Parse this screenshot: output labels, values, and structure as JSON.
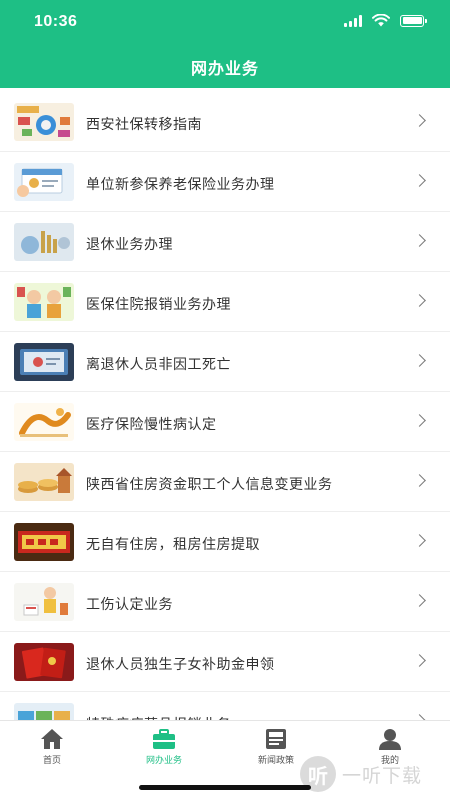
{
  "status_bar": {
    "time": "10:36"
  },
  "header": {
    "title": "网办业务"
  },
  "list": {
    "items": [
      {
        "label": "西安社保转移指南",
        "thumb_icon": "social-insurance-diagram-thumb"
      },
      {
        "label": "单位新参保养老保险业务办理",
        "thumb_icon": "insurance-card-thumb"
      },
      {
        "label": "退休业务办理",
        "thumb_icon": "retirement-thumb"
      },
      {
        "label": "医保住院报销业务办理",
        "thumb_icon": "elderly-couple-thumb"
      },
      {
        "label": "离退休人员非因工死亡",
        "thumb_icon": "certificate-thumb"
      },
      {
        "label": "医疗保险慢性病认定",
        "thumb_icon": "medical-insurance-thumb"
      },
      {
        "label": "陕西省住房资金职工个人信息变更业务",
        "thumb_icon": "housing-fund-thumb"
      },
      {
        "label": "无自有住房，租房住房提取",
        "thumb_icon": "rental-housing-thumb"
      },
      {
        "label": "工伤认定业务",
        "thumb_icon": "work-injury-thumb"
      },
      {
        "label": "退休人员独生子女补助金申领",
        "thumb_icon": "red-booklet-thumb"
      },
      {
        "label": "特殊疾病药品报销业务",
        "thumb_icon": "medicine-thumb"
      }
    ]
  },
  "tabbar": {
    "tabs": [
      {
        "label": "首页",
        "icon": "home-icon",
        "active": false
      },
      {
        "label": "网办业务",
        "icon": "briefcase-icon",
        "active": true
      },
      {
        "label": "新闻政策",
        "icon": "news-icon",
        "active": false
      },
      {
        "label": "我的",
        "icon": "person-icon",
        "active": false
      }
    ]
  },
  "watermark": {
    "text": "一听下载",
    "glyph": "听"
  },
  "colors": {
    "brand_green": "#1ebf85",
    "text": "#333333",
    "divider": "#eeeeee"
  }
}
